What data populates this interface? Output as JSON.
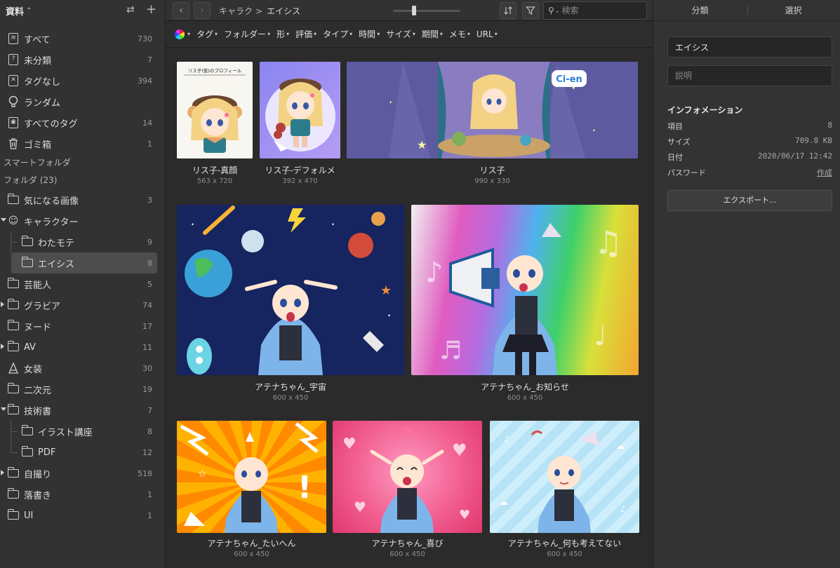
{
  "sidebar": {
    "library_title": "資料",
    "library_chevron": "⌃⌄",
    "sync_icon": "⇄",
    "add_icon": "+",
    "main_items": [
      {
        "label": "すべて",
        "count": "730",
        "icon": "all-items-icon"
      },
      {
        "label": "未分類",
        "count": "7",
        "icon": "unsorted-icon"
      },
      {
        "label": "タグなし",
        "count": "394",
        "icon": "untagged-icon"
      },
      {
        "label": "ランダム",
        "count": "",
        "icon": "bulb-icon"
      },
      {
        "label": "すべてのタグ",
        "count": "14",
        "icon": "tag-icon"
      },
      {
        "label": "ゴミ箱",
        "count": "1",
        "icon": "trash-icon"
      }
    ],
    "smart_folder_label": "スマートフォルダ",
    "folders_label": "フォルダ (23)",
    "folders": [
      {
        "label": "気になる画像",
        "count": "3"
      },
      {
        "label": "キャラクター",
        "count": ""
      },
      {
        "label": "わたモテ",
        "count": "9"
      },
      {
        "label": "エイシス",
        "count": "8"
      },
      {
        "label": "芸能人",
        "count": "5"
      },
      {
        "label": "グラビア",
        "count": "74"
      },
      {
        "label": "ヌード",
        "count": "17"
      },
      {
        "label": "AV",
        "count": "11"
      },
      {
        "label": "女装",
        "count": "30"
      },
      {
        "label": "二次元",
        "count": "19"
      },
      {
        "label": "技術書",
        "count": "7"
      },
      {
        "label": "イラスト講座",
        "count": "8"
      },
      {
        "label": "PDF",
        "count": "12"
      },
      {
        "label": "自撮り",
        "count": "518"
      },
      {
        "label": "落書き",
        "count": "1"
      },
      {
        "label": "UI",
        "count": "1"
      }
    ]
  },
  "toolbar": {
    "back": "‹",
    "forward": "›",
    "breadcrumb_parent": "キャラクター",
    "breadcrumb_sep": ">",
    "breadcrumb_current": "エイシス",
    "search_placeholder": "検索",
    "zoom_level": 0.3
  },
  "filters": [
    "タグ",
    "フォルダー",
    "形",
    "評価",
    "タイプ",
    "時間",
    "サイズ",
    "期間",
    "メモ",
    "URL"
  ],
  "items": [
    {
      "name": "リス子-真顔",
      "dim": "563 x 720"
    },
    {
      "name": "リス子-デフォルメ",
      "dim": "392 x 470"
    },
    {
      "name": "リス子",
      "dim": "990 x 330"
    },
    {
      "name": "アテナちゃん_宇宙",
      "dim": "600 x 450"
    },
    {
      "name": "アテナちゃん_お知らせ",
      "dim": "600 x 450"
    },
    {
      "name": "アテナちゃん_たいへん",
      "dim": "600 x 450"
    },
    {
      "name": "アテナちゃん_喜び",
      "dim": "600 x 450"
    },
    {
      "name": "アテナちゃん_何も考えてない",
      "dim": "600 x 450"
    }
  ],
  "thumb_texts": {
    "profile_title": "リス子(仮)のプロフィール",
    "cien_logo": "Ci-en"
  },
  "inspector": {
    "tab_classify": "分類",
    "tab_select": "選択",
    "name_value": "エイシス",
    "desc_placeholder": "説明",
    "info_heading": "インフォメーション",
    "rows": [
      {
        "k": "項目",
        "v": "8"
      },
      {
        "k": "サイズ",
        "v": "709.8 KB"
      },
      {
        "k": "日付",
        "v": "2020/06/17 12:42"
      }
    ],
    "password_label": "パスワード",
    "password_action": "作成",
    "export_label": "エクスポート..."
  }
}
